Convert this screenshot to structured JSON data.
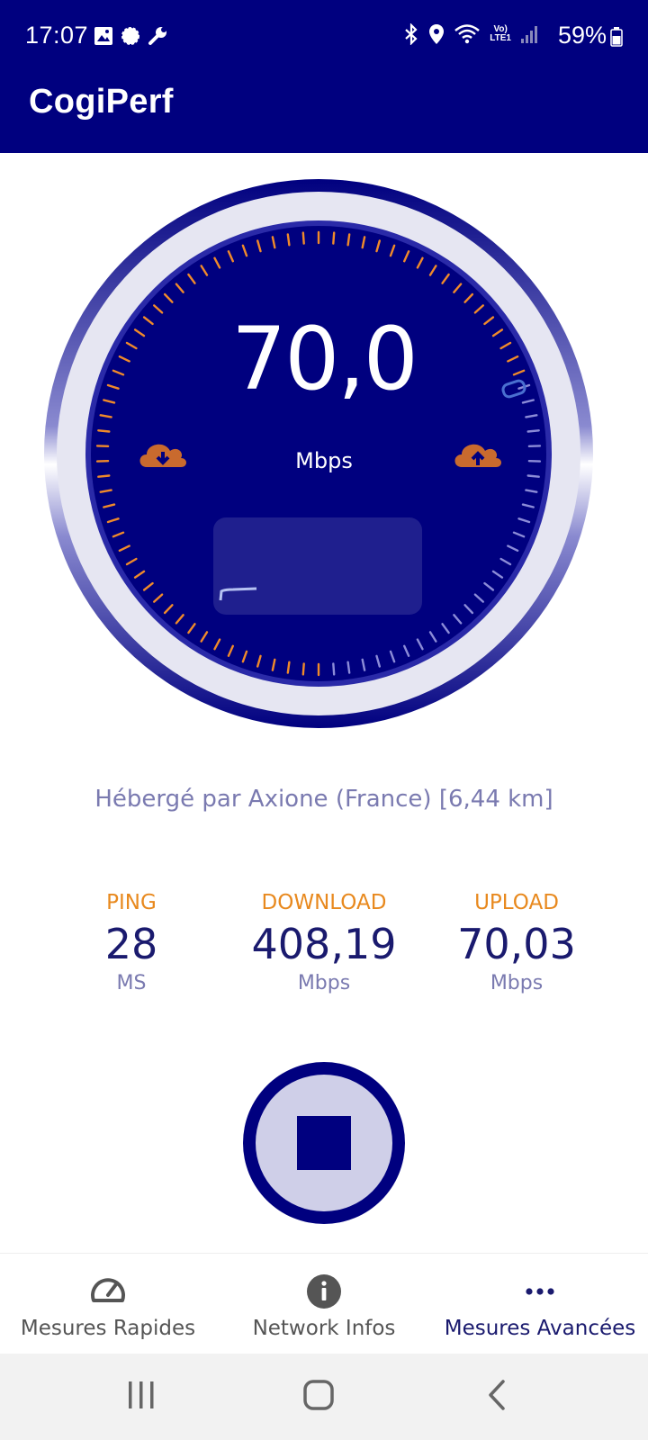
{
  "status_bar": {
    "time": "17:07",
    "battery": "59%",
    "left_icons": [
      "gallery-icon",
      "signal-app-icon",
      "wrench-icon"
    ],
    "right_icons": [
      "bluetooth-icon",
      "location-icon",
      "wifi-icon",
      "volte-icon",
      "cell-signal-icon"
    ],
    "volte_label": "Vo)",
    "lte_label": "LTE1"
  },
  "app_bar": {
    "title": "CogiPerf"
  },
  "gauge": {
    "value": "70,0",
    "unit": "Mbps",
    "left_icon": "download-cloud-icon",
    "right_icon": "upload-cloud-icon"
  },
  "server": {
    "text": "Hébergé par Axione (France) [6,44 km]"
  },
  "stats": [
    {
      "label": "PING",
      "value": "28",
      "unit": "MS"
    },
    {
      "label": "DOWNLOAD",
      "value": "408,19",
      "unit": "Mbps"
    },
    {
      "label": "UPLOAD",
      "value": "70,03",
      "unit": "Mbps"
    }
  ],
  "stop_button": {
    "icon": "stop-icon"
  },
  "bottom_nav": [
    {
      "label": "Mesures Rapides",
      "icon": "speedometer-icon",
      "active": false
    },
    {
      "label": "Network Infos",
      "icon": "info-icon",
      "active": false
    },
    {
      "label": "Mesures Avancées",
      "icon": "more-dots-icon",
      "active": true
    }
  ],
  "system_nav": [
    "recent-apps-icon",
    "home-icon",
    "back-icon"
  ],
  "colors": {
    "primary": "#00007f",
    "accent": "#e8891e",
    "gauge_ring": "#e6e6f2",
    "tick_orange": "#f08a2a",
    "tick_blue": "#8c8cd8",
    "muted_text": "#7a7ab0"
  }
}
